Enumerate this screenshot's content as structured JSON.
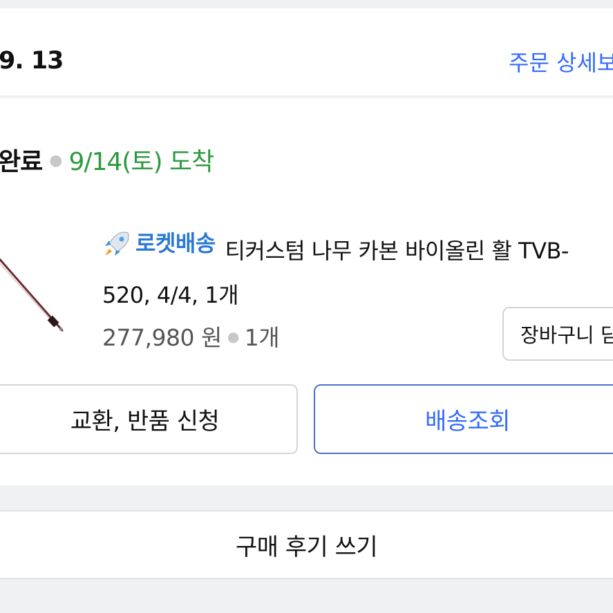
{
  "header": {
    "order_date": "9. 13",
    "order_detail_link": "주문 상세보기"
  },
  "shipment": {
    "status": "완료",
    "arrival": "9/14(토) 도착"
  },
  "product": {
    "badge": "로켓배송",
    "title_line1": "티커스텀 나무 카본 바이올린 활 TVB-",
    "title_line2": "520, 4/4, 1개",
    "price": "277,980 원",
    "quantity": "1개",
    "cart_button": "장바구니 담기"
  },
  "actions": {
    "exchange_return": "교환, 반품 신청",
    "track_delivery": "배송조회",
    "write_review": "구매 후기 쓰기"
  },
  "colors": {
    "link_blue": "#346aff",
    "arrival_green": "#2e9a3f",
    "rocket_blue": "#2b79d4"
  }
}
